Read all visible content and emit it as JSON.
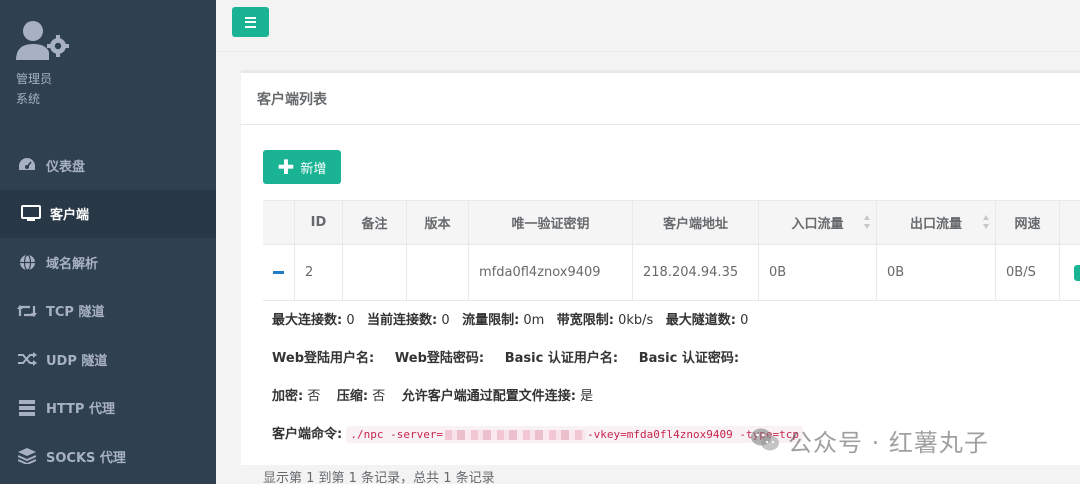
{
  "user": {
    "name": "管理员",
    "role": "系统"
  },
  "nav": [
    {
      "label": "仪表盘",
      "icon": "dashboard-icon",
      "active": false
    },
    {
      "label": "客户端",
      "icon": "monitor-icon",
      "active": true
    },
    {
      "label": "域名解析",
      "icon": "globe-icon",
      "active": false
    },
    {
      "label": "TCP 隧道",
      "icon": "retweet-icon",
      "active": false
    },
    {
      "label": "UDP 隧道",
      "icon": "shuffle-icon",
      "active": false
    },
    {
      "label": "HTTP 代理",
      "icon": "server-icon",
      "active": false
    },
    {
      "label": "SOCKS 代理",
      "icon": "layers-icon",
      "active": false
    }
  ],
  "panel": {
    "title": "客户端列表",
    "add_label": "新增"
  },
  "table": {
    "headers": [
      "ID",
      "备注",
      "版本",
      "唯一验证密钥",
      "客户端地址",
      "入口流量",
      "出口流量",
      "网速"
    ],
    "row": {
      "id": "2",
      "remark": "",
      "version": "",
      "vkey": "mfda0fl4znox9409",
      "address": "218.204.94.35",
      "in_flow": "0B",
      "out_flow": "0B",
      "speed": "0B/S"
    }
  },
  "detail": {
    "max_conn_label": "最大连接数:",
    "max_conn": "0",
    "cur_conn_label": "当前连接数:",
    "cur_conn": "0",
    "flow_limit_label": "流量限制:",
    "flow_limit": "0m",
    "rate_limit_label": "带宽限制:",
    "rate_limit": "0kb/s",
    "max_tunnel_label": "最大隧道数:",
    "max_tunnel": "0",
    "web_user_label": "Web登陆用户名:",
    "web_pass_label": "Web登陆密码:",
    "basic_user_label": "Basic 认证用户名:",
    "basic_pass_label": "Basic 认证密码:",
    "crypt_label": "加密:",
    "crypt": "否",
    "compress_label": "压缩:",
    "compress": "否",
    "config_conn_label": "允许客户端通过配置文件连接:",
    "config_conn": "是",
    "cmd_label": "客户端命令:",
    "cmd_prefix": "./npc -server=",
    "cmd_suffix": "-vkey=mfda0fl4znox9409 -type=tcp"
  },
  "footer": "显示第 1 到第 1 条记录，总共 1 条记录",
  "watermark": "公众号 · 红薯丸子",
  "colors": {
    "sidebar": "#2f4050",
    "accent": "#1ab394",
    "link": "#1e7bc6"
  }
}
